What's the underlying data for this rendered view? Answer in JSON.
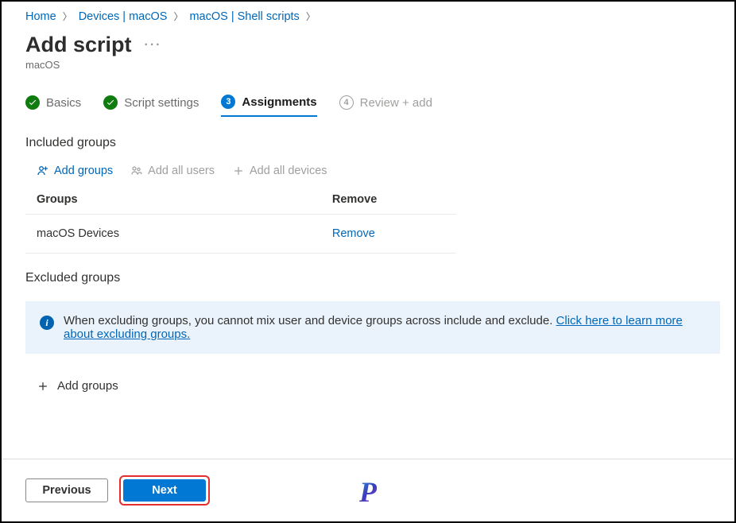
{
  "breadcrumb": {
    "items": [
      {
        "label": "Home"
      },
      {
        "label": "Devices | macOS"
      },
      {
        "label": "macOS | Shell scripts"
      }
    ]
  },
  "page": {
    "title": "Add script",
    "subtitle": "macOS"
  },
  "wizard": {
    "step1": "Basics",
    "step2": "Script settings",
    "step3": "Assignments",
    "step3_num": "3",
    "step4": "Review + add",
    "step4_num": "4"
  },
  "included": {
    "title": "Included groups",
    "add_groups": "Add groups",
    "add_all_users": "Add all users",
    "add_all_devices": "Add all devices",
    "col_groups": "Groups",
    "col_remove": "Remove",
    "rows": [
      {
        "name": "macOS Devices",
        "action": "Remove"
      }
    ]
  },
  "excluded": {
    "title": "Excluded groups",
    "info_text": "When excluding groups, you cannot mix user and device groups across include and exclude. ",
    "info_link": "Click here to learn more about excluding groups.",
    "add_groups": "Add groups"
  },
  "footer": {
    "previous": "Previous",
    "next": "Next"
  },
  "logo": "P"
}
